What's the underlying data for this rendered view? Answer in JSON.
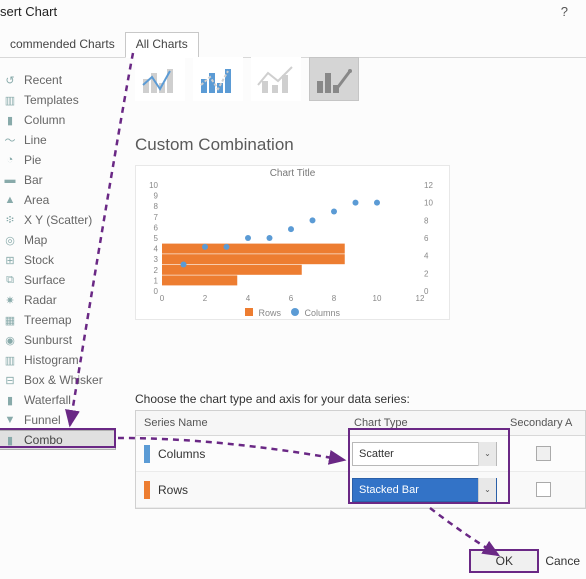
{
  "header": {
    "title": "sert Chart",
    "help": "?"
  },
  "tabs": {
    "recommended": "commended Charts",
    "all": "All Charts"
  },
  "sidebar": {
    "items": [
      {
        "label": "Recent",
        "icon": "↺"
      },
      {
        "label": "Templates",
        "icon": "▥"
      },
      {
        "label": "Column",
        "icon": "▮"
      },
      {
        "label": "Line",
        "icon": "〜"
      },
      {
        "label": "Pie",
        "icon": "◔"
      },
      {
        "label": "Bar",
        "icon": "▬"
      },
      {
        "label": "Area",
        "icon": "▲"
      },
      {
        "label": "X Y (Scatter)",
        "icon": "፨"
      },
      {
        "label": "Map",
        "icon": "◎"
      },
      {
        "label": "Stock",
        "icon": "⊞"
      },
      {
        "label": "Surface",
        "icon": "⧉"
      },
      {
        "label": "Radar",
        "icon": "✷"
      },
      {
        "label": "Treemap",
        "icon": "▦"
      },
      {
        "label": "Sunburst",
        "icon": "◉"
      },
      {
        "label": "Histogram",
        "icon": "▥"
      },
      {
        "label": "Box & Whisker",
        "icon": "⊟"
      },
      {
        "label": "Waterfall",
        "icon": "▮"
      },
      {
        "label": "Funnel",
        "icon": "▼"
      },
      {
        "label": "Combo",
        "icon": "▮"
      }
    ]
  },
  "section_title": "Custom Combination",
  "chart_data": {
    "title": "Chart Title",
    "left_axis": {
      "min": 0,
      "max": 10,
      "ticks": [
        0,
        1,
        2,
        3,
        4,
        5,
        6,
        7,
        8,
        9,
        10
      ]
    },
    "right_axis": {
      "min": 0,
      "max": 12,
      "ticks": [
        0,
        2,
        4,
        6,
        8,
        10,
        12
      ]
    },
    "series": [
      {
        "name": "Rows",
        "type": "stacked_bar",
        "axis": "left",
        "x": [
          1,
          2,
          3,
          4
        ],
        "y": [
          3.5,
          6.5,
          8.5,
          8.5
        ],
        "color": "#ed7d31"
      },
      {
        "name": "Columns",
        "type": "scatter",
        "axis": "right",
        "x": [
          1,
          2,
          3,
          4,
          5,
          6,
          7,
          8,
          9,
          10
        ],
        "y": [
          3,
          5,
          5,
          6,
          6,
          7,
          8,
          9,
          10,
          10
        ],
        "color": "#5b9bd5"
      }
    ],
    "legend": [
      "Rows",
      "Columns"
    ],
    "x_ticks": [
      0,
      2,
      4,
      6,
      8,
      10,
      12
    ]
  },
  "series_label": "Choose the chart type and axis for your data series:",
  "series_headers": {
    "name": "Series Name",
    "type": "Chart Type",
    "secondary": "Secondary A"
  },
  "series_rows": [
    {
      "name": "Columns",
      "type": "Scatter",
      "secondary": false
    },
    {
      "name": "Rows",
      "type": "Stacked Bar",
      "secondary": false
    }
  ],
  "buttons": {
    "ok": "OK",
    "cancel": "Cance"
  }
}
